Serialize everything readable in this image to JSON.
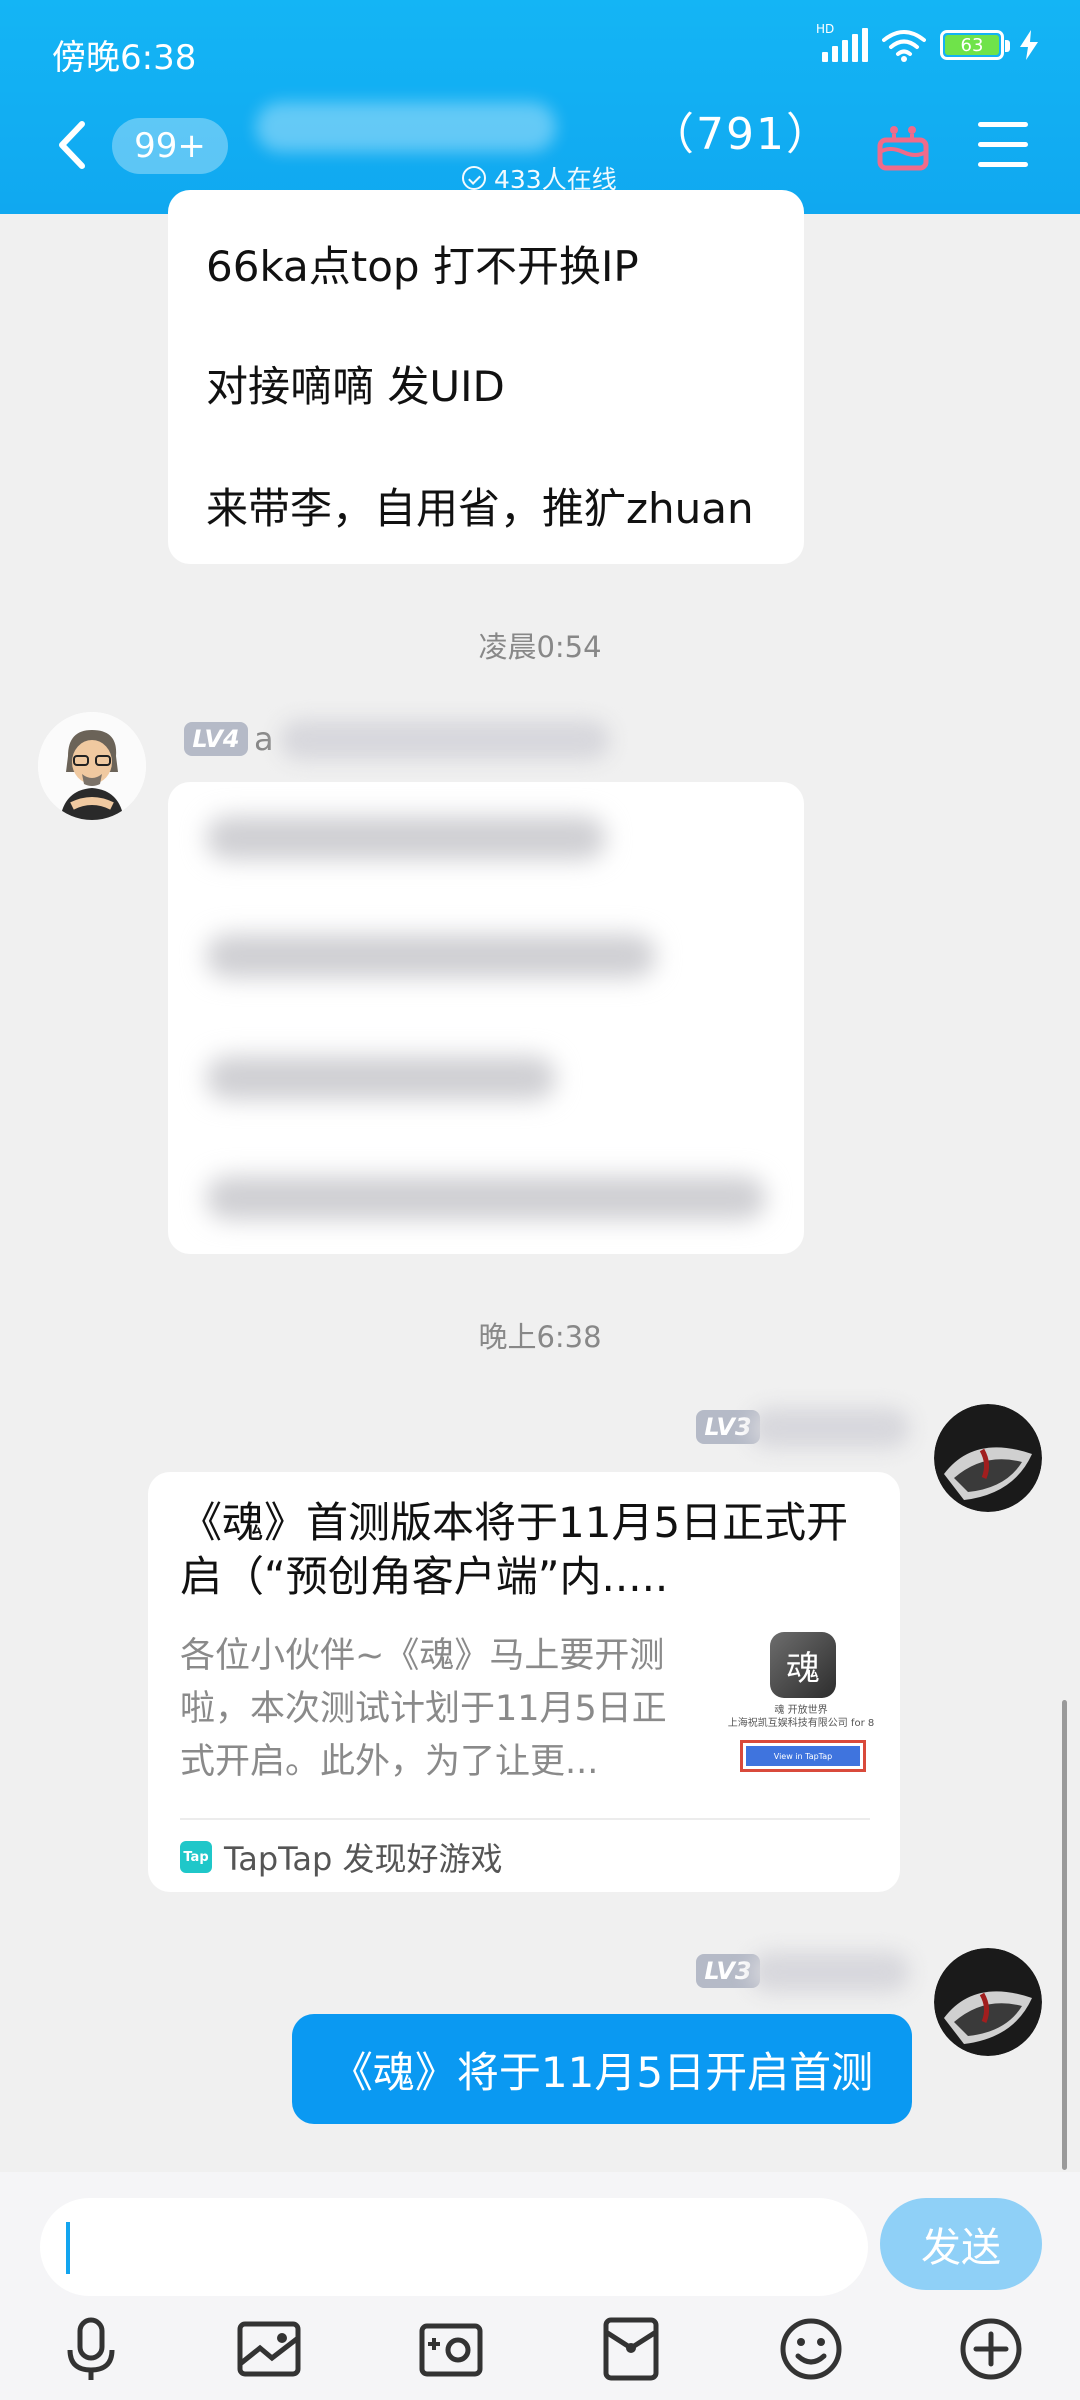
{
  "status_bar": {
    "time": "傍晚6:38",
    "network": "HD",
    "battery": "63"
  },
  "header": {
    "unread_count": "99+",
    "member_count": "（791）",
    "online": "433人在线"
  },
  "messages": {
    "first_bubble": [
      "66ka点top  打不开换IP",
      "对接嘀嘀   发UID",
      "来带李，自用省，推犷zhuan"
    ],
    "time1": "凌晨0:54",
    "user1_level": "LV4",
    "user1_nick_initial": "a",
    "time2": "晚上6:38",
    "user2_level": "LV3",
    "card": {
      "title": "《魂》首测版本将于11月5日正式开启（“预创角客户端”内.....",
      "desc": "各位小伙伴~《魂》马上要开测啦，本次测试计划于11月5日正式开启。此外，为了让更...",
      "thumb_logo": "魂",
      "thumb_caption": "魂 开放世界\n上海祝凯互娱科技有限公司 for 8",
      "thumb_button": "View in TapTap",
      "source_logo": "Tap",
      "source": "TapTap 发现好游戏"
    },
    "user3_level": "LV3",
    "my_message": "《魂》将于11月5日开启首测"
  },
  "input_bar": {
    "send_label": "发送"
  },
  "colors": {
    "header": "#10a8f0",
    "my_bubble": "#0a99f2",
    "send_button": "#8fd0f7"
  },
  "icons": [
    "back-icon",
    "gift-icon",
    "menu-icon",
    "mic-icon",
    "image-icon",
    "camera-icon",
    "red-packet-icon",
    "emoji-icon",
    "plus-icon"
  ]
}
